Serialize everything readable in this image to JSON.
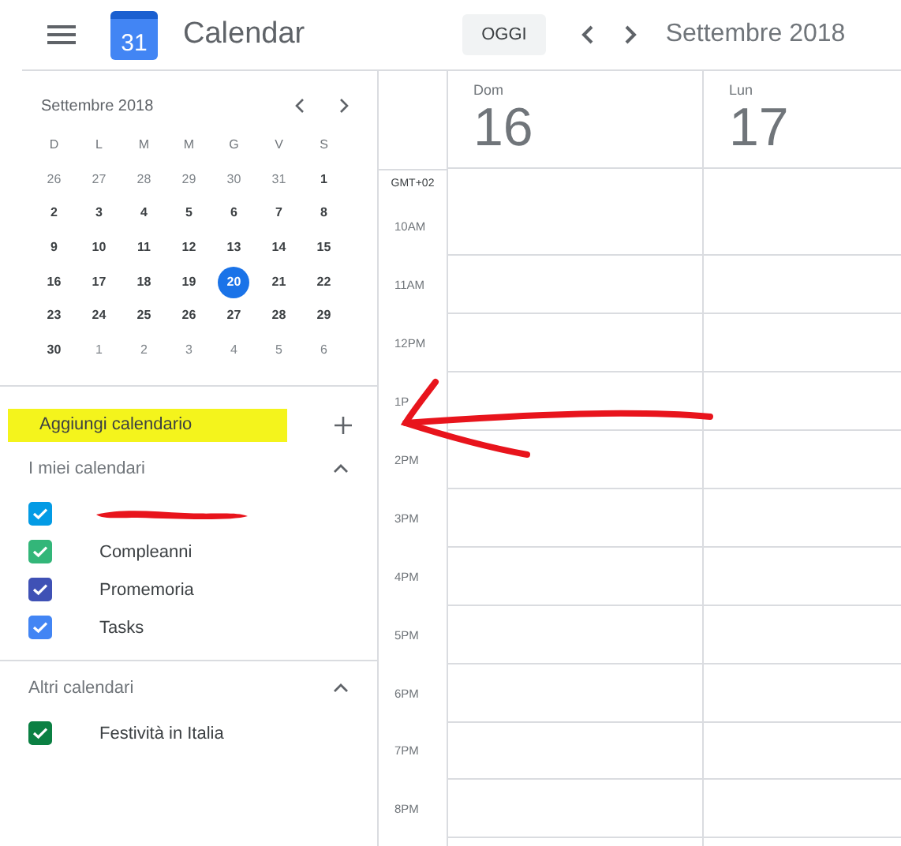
{
  "header": {
    "app_title": "Calendar",
    "logo_day": "31",
    "today_button": "OGGI",
    "period": "Settembre 2018"
  },
  "mini_calendar": {
    "title": "Settembre 2018",
    "weekdays": [
      "D",
      "L",
      "M",
      "M",
      "G",
      "V",
      "S"
    ],
    "weeks": [
      [
        {
          "day": "26",
          "other_month": true,
          "selected": false
        },
        {
          "day": "27",
          "other_month": true,
          "selected": false
        },
        {
          "day": "28",
          "other_month": true,
          "selected": false
        },
        {
          "day": "29",
          "other_month": true,
          "selected": false
        },
        {
          "day": "30",
          "other_month": true,
          "selected": false
        },
        {
          "day": "31",
          "other_month": true,
          "selected": false
        },
        {
          "day": "1",
          "other_month": false,
          "selected": false
        }
      ],
      [
        {
          "day": "2",
          "other_month": false,
          "selected": false
        },
        {
          "day": "3",
          "other_month": false,
          "selected": false
        },
        {
          "day": "4",
          "other_month": false,
          "selected": false
        },
        {
          "day": "5",
          "other_month": false,
          "selected": false
        },
        {
          "day": "6",
          "other_month": false,
          "selected": false
        },
        {
          "day": "7",
          "other_month": false,
          "selected": false
        },
        {
          "day": "8",
          "other_month": false,
          "selected": false
        }
      ],
      [
        {
          "day": "9",
          "other_month": false,
          "selected": false
        },
        {
          "day": "10",
          "other_month": false,
          "selected": false
        },
        {
          "day": "11",
          "other_month": false,
          "selected": false
        },
        {
          "day": "12",
          "other_month": false,
          "selected": false
        },
        {
          "day": "13",
          "other_month": false,
          "selected": false
        },
        {
          "day": "14",
          "other_month": false,
          "selected": false
        },
        {
          "day": "15",
          "other_month": false,
          "selected": false
        }
      ],
      [
        {
          "day": "16",
          "other_month": false,
          "selected": false
        },
        {
          "day": "17",
          "other_month": false,
          "selected": false
        },
        {
          "day": "18",
          "other_month": false,
          "selected": false
        },
        {
          "day": "19",
          "other_month": false,
          "selected": false
        },
        {
          "day": "20",
          "other_month": false,
          "selected": true
        },
        {
          "day": "21",
          "other_month": false,
          "selected": false
        },
        {
          "day": "22",
          "other_month": false,
          "selected": false
        }
      ],
      [
        {
          "day": "23",
          "other_month": false,
          "selected": false
        },
        {
          "day": "24",
          "other_month": false,
          "selected": false
        },
        {
          "day": "25",
          "other_month": false,
          "selected": false
        },
        {
          "day": "26",
          "other_month": false,
          "selected": false
        },
        {
          "day": "27",
          "other_month": false,
          "selected": false
        },
        {
          "day": "28",
          "other_month": false,
          "selected": false
        },
        {
          "day": "29",
          "other_month": false,
          "selected": false
        }
      ],
      [
        {
          "day": "30",
          "other_month": false,
          "selected": false
        },
        {
          "day": "1",
          "other_month": true,
          "selected": false
        },
        {
          "day": "2",
          "other_month": true,
          "selected": false
        },
        {
          "day": "3",
          "other_month": true,
          "selected": false
        },
        {
          "day": "4",
          "other_month": true,
          "selected": false
        },
        {
          "day": "5",
          "other_month": true,
          "selected": false
        },
        {
          "day": "6",
          "other_month": true,
          "selected": false
        }
      ]
    ]
  },
  "add_calendar": {
    "placeholder": "Aggiungi calendario",
    "highlighted": true
  },
  "sections": [
    {
      "title": "I miei calendari",
      "expanded": true,
      "calendars": [
        {
          "redacted": true,
          "color": "#039be5",
          "checked": true
        },
        {
          "label": "Compleanni",
          "color": "#33b679",
          "checked": true
        },
        {
          "label": "Promemoria",
          "color": "#3f51b5",
          "checked": true
        },
        {
          "label": "Tasks",
          "color": "#4285f4",
          "checked": true
        }
      ]
    },
    {
      "title": "Altri calendari",
      "expanded": true,
      "calendars": [
        {
          "label": "Festività in Italia",
          "color": "#0b8043",
          "checked": true
        }
      ]
    }
  ],
  "time_grid": {
    "timezone": "GMT+02",
    "hours": [
      "10AM",
      "11AM",
      "12PM",
      "1P",
      "2PM",
      "3PM",
      "4PM",
      "5PM",
      "6PM",
      "7PM",
      "8PM"
    ],
    "days": [
      {
        "weekday": "Dom",
        "date": "16"
      },
      {
        "weekday": "Lun",
        "date": "17"
      }
    ]
  }
}
